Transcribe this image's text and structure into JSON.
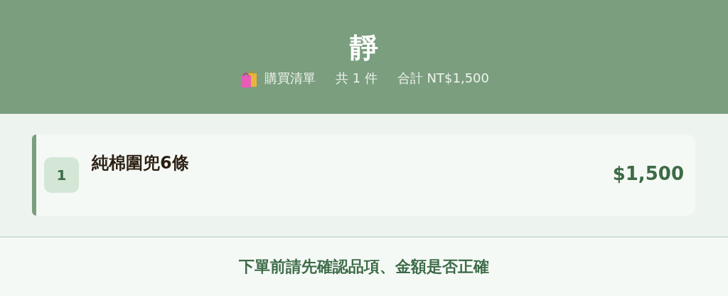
{
  "header": {
    "title": "靜",
    "subtitle": {
      "label": "購買清單",
      "count": "共 1 件",
      "total": "合計 NT$1,500"
    }
  },
  "items": [
    {
      "index": "1",
      "name": "純棉圍兜6條",
      "price": "$1,500"
    }
  ],
  "footer": {
    "notice": "下單前請先確認品項、金額是否正確"
  }
}
